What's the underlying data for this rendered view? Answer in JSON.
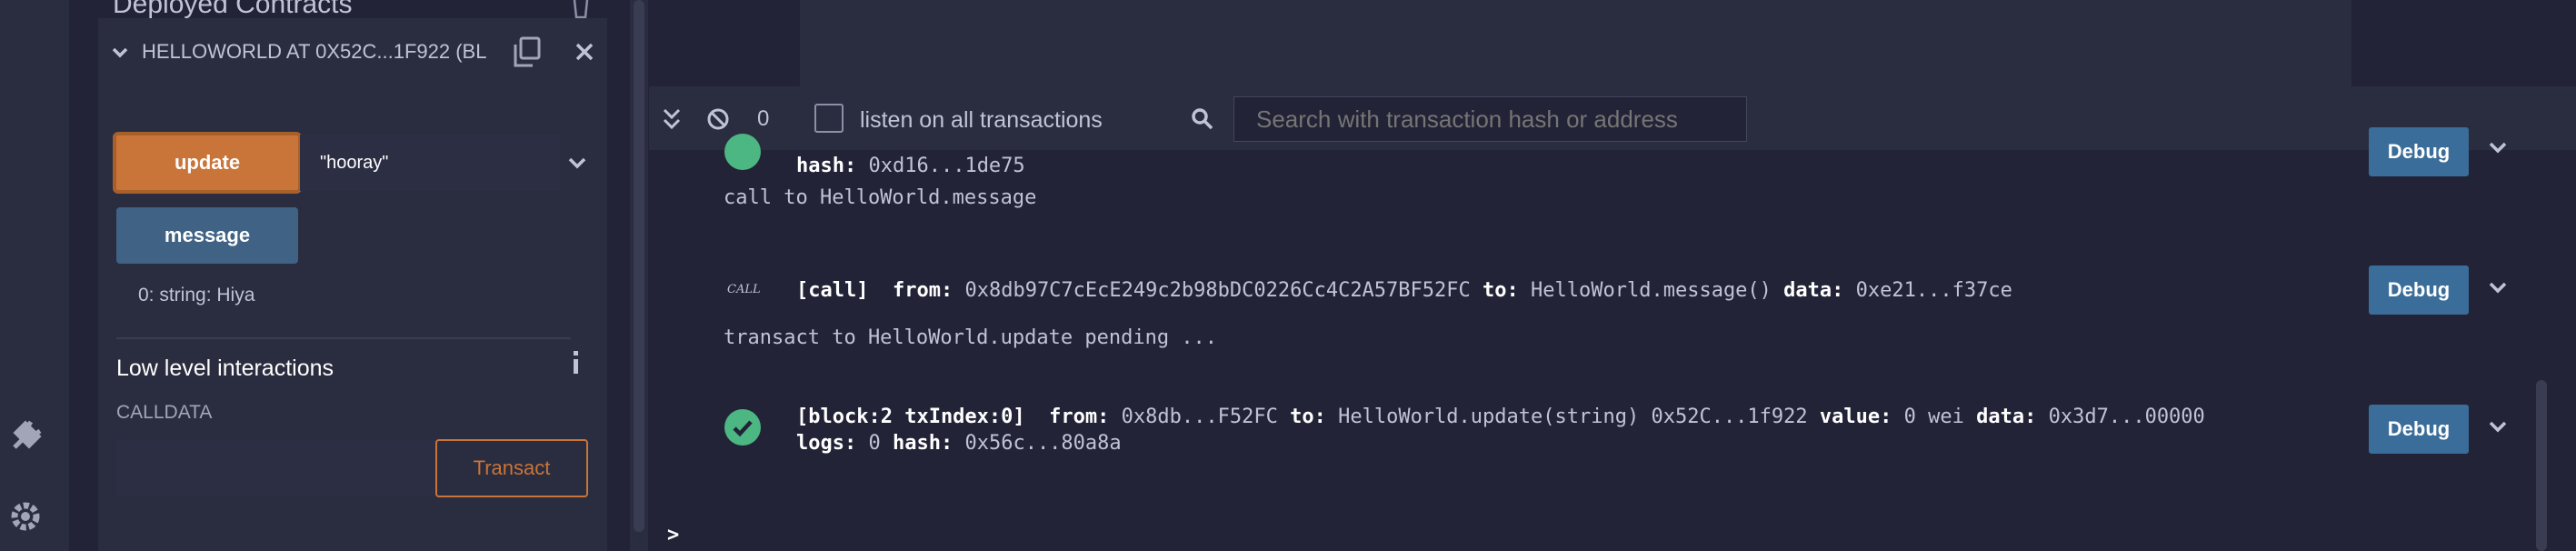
{
  "panel": {
    "section_title": "Deployed Contracts",
    "contract_title": "HELLOWORLD AT 0X52C...1F922 (BL",
    "update_button": "update",
    "update_input_value": "\"hooray\"",
    "message_button": "message",
    "message_result": "0: string: Hiya",
    "low_level_title": "Low level interactions",
    "calldata_label": "CALLDATA",
    "transact_button": "Transact"
  },
  "terminal": {
    "pending_count": "0",
    "listen_label": "listen on all transactions",
    "search_placeholder": "Search with transaction hash or address",
    "debug_label": "Debug",
    "prompt": ">",
    "entries": {
      "e1_hash_key": "hash:",
      "e1_hash_val": "0xd16...1de75",
      "line_call": "call to HelloWorld.message",
      "call_badge": "CALL",
      "e2_tag": "[call]",
      "e2_from_key": "from:",
      "e2_from_val": "0x8db97C7cEcE249c2b98bDC0226Cc4C2A57BF52FC",
      "e2_to_key": "to:",
      "e2_to_val": "HelloWorld.message()",
      "e2_data_key": "data:",
      "e2_data_val": "0xe21...f37ce",
      "line_pending": "transact to HelloWorld.update pending ...",
      "e3_tag": "[block:2 txIndex:0]",
      "e3_from_key": "from:",
      "e3_from_val": "0x8db...F52FC",
      "e3_to_key": "to:",
      "e3_to_val": "HelloWorld.update(string) 0x52C...1f922",
      "e3_value_key": "value:",
      "e3_value_val": "0 wei",
      "e3_data_key": "data:",
      "e3_data_val": "0x3d7...00000",
      "e3_logs_key": "logs:",
      "e3_logs_val": "0",
      "e3_hash_key": "hash:",
      "e3_hash_val": "0x56c...80a8a"
    }
  },
  "colors": {
    "accent_orange": "#c97539",
    "debug_blue": "#3a6d99",
    "success_green": "#4cb782",
    "background": "#222336"
  }
}
